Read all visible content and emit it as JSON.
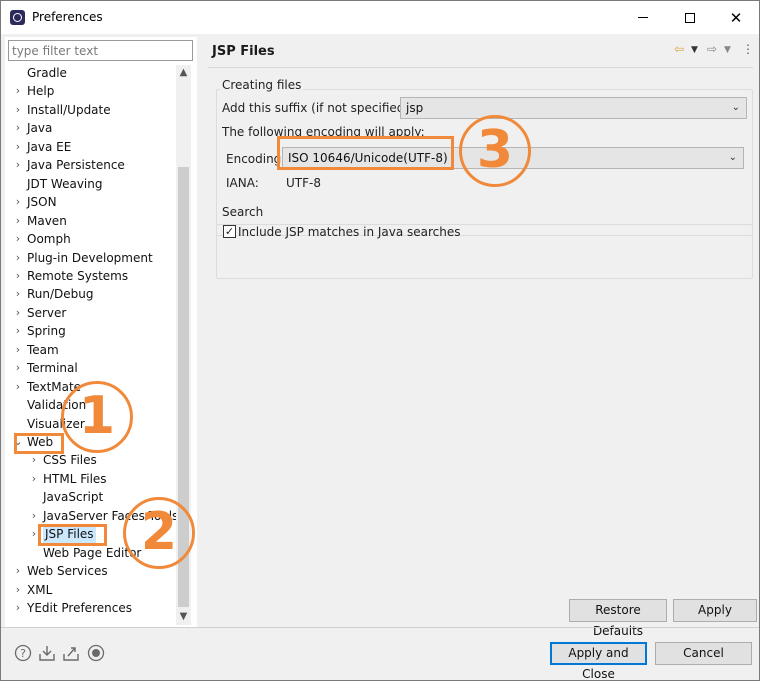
{
  "window": {
    "title": "Preferences",
    "minimize": "—",
    "close": "✕"
  },
  "left": {
    "filter_placeholder": "type filter text",
    "tree": [
      {
        "label": "Gradle",
        "arrow": ""
      },
      {
        "label": "Help",
        "arrow": "›"
      },
      {
        "label": "Install/Update",
        "arrow": "›"
      },
      {
        "label": "Java",
        "arrow": "›"
      },
      {
        "label": "Java EE",
        "arrow": "›"
      },
      {
        "label": "Java Persistence",
        "arrow": "›"
      },
      {
        "label": "JDT Weaving",
        "arrow": ""
      },
      {
        "label": "JSON",
        "arrow": "›"
      },
      {
        "label": "Maven",
        "arrow": "›"
      },
      {
        "label": "Oomph",
        "arrow": "›"
      },
      {
        "label": "Plug-in Development",
        "arrow": "›"
      },
      {
        "label": "Remote Systems",
        "arrow": "›"
      },
      {
        "label": "Run/Debug",
        "arrow": "›"
      },
      {
        "label": "Server",
        "arrow": "›"
      },
      {
        "label": "Spring",
        "arrow": "›"
      },
      {
        "label": "Team",
        "arrow": "›"
      },
      {
        "label": "Terminal",
        "arrow": "›"
      },
      {
        "label": "TextMate",
        "arrow": "›"
      },
      {
        "label": "Validation",
        "arrow": ""
      },
      {
        "label": "Visualizer",
        "arrow": ""
      },
      {
        "label": "Web",
        "arrow": "⌄"
      },
      {
        "label": "CSS Files",
        "arrow": "›"
      },
      {
        "label": "HTML Files",
        "arrow": "›"
      },
      {
        "label": "JavaScript",
        "arrow": ""
      },
      {
        "label": "JavaServer Faces Tools",
        "arrow": "›"
      },
      {
        "label": "JSP Files",
        "arrow": "›"
      },
      {
        "label": "Web Page Editor",
        "arrow": ""
      },
      {
        "label": "Web Services",
        "arrow": "›"
      },
      {
        "label": "XML",
        "arrow": "›"
      },
      {
        "label": "YEdit Preferences",
        "arrow": "›"
      }
    ]
  },
  "main": {
    "title": "JSP Files",
    "creating_group": "Creating files",
    "suffix_label": "Add this suffix (if not specified):",
    "suffix_value": "jsp",
    "encoding_intro": "The following encoding will apply:",
    "encoding_label": "Encoding:",
    "encoding_value": "ISO 10646/Unicode(UTF-8)",
    "iana_label": "IANA:",
    "iana_value": "UTF-8",
    "search_group": "Search",
    "include_label": "Include JSP matches in Java searches",
    "restore_label": "Restore Defaults",
    "apply_label": "Apply"
  },
  "footer": {
    "apply_close_label": "Apply and Close",
    "cancel_label": "Cancel"
  },
  "annotations": [
    "1",
    "2",
    "3"
  ],
  "colors": {
    "annotation": "#f0893a",
    "selection": "#cce8ff",
    "accent": "#0078d7"
  }
}
